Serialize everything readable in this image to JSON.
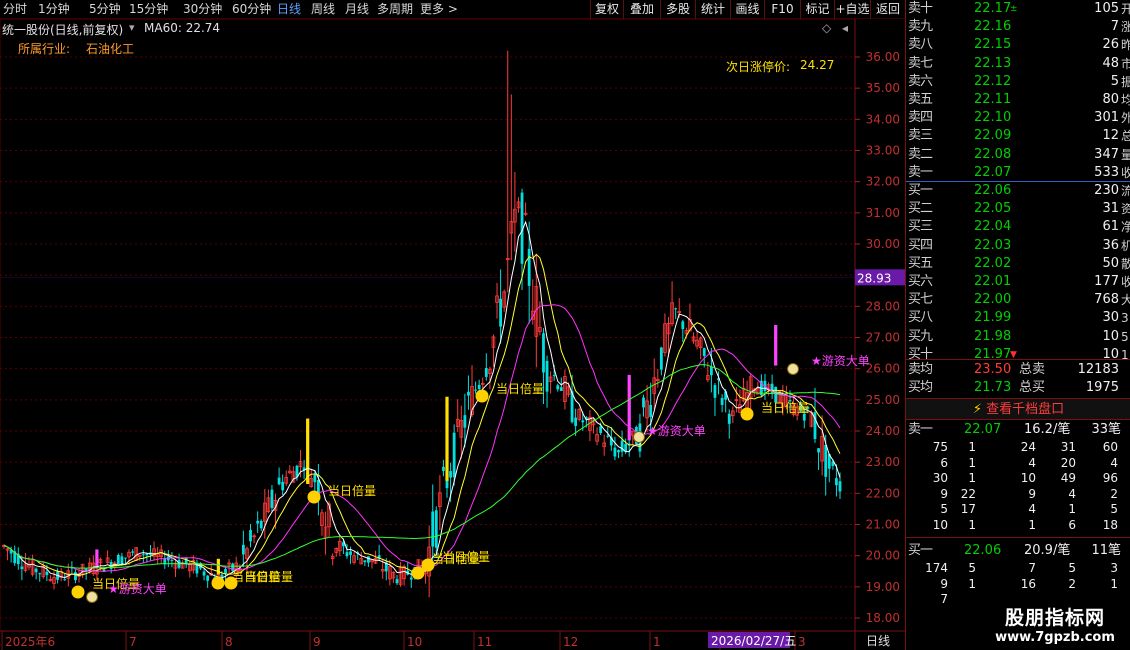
{
  "toolbar": {
    "periods": [
      "分时",
      "1分钟",
      "5分钟",
      "15分钟",
      "30分钟",
      "60分钟",
      "日线",
      "周线",
      "月线",
      "多周期",
      "更多 >"
    ],
    "active_period": "日线",
    "right_buttons": [
      "复权",
      "叠加",
      "多股",
      "统计",
      "画线",
      "F10",
      "标记",
      "+自选",
      "返回"
    ]
  },
  "chart": {
    "title": "统一股份(日线,前复权)",
    "ma_label": "MA60: 22.74",
    "industry_label": "所属行业:",
    "industry_value": "石油化工",
    "limit_up_label": "次日涨停价:",
    "limit_up_value": "24.27",
    "price_tag": "28.93",
    "date_tag": "2026/02/27/五",
    "period_label": "日线",
    "y_ticks": [
      "36.00",
      "35.00",
      "34.00",
      "33.00",
      "32.00",
      "31.00",
      "30.00",
      "29.00",
      "28.00",
      "27.00",
      "26.00",
      "25.00",
      "24.00",
      "23.00",
      "22.00",
      "21.00",
      "20.00",
      "19.00",
      "18.00"
    ],
    "x_labels": [
      "2025年6",
      "7",
      "8",
      "9",
      "10",
      "11",
      "12",
      "1",
      "2",
      "3"
    ],
    "annotations": {
      "double_volume": "当日倍量",
      "hot_money": "游资大单"
    },
    "colors": {
      "up": "#ff3b3b",
      "down": "#00e0e0",
      "ma_white": "#ffffff",
      "ma_yellow": "#ffff33",
      "ma_magenta": "#ff33ff",
      "ma_green": "#33ff33",
      "signal_yellow": "#ffe000",
      "signal_magenta": "#ff44ff"
    }
  },
  "chart_data": {
    "type": "candlestick",
    "title": "统一股份(日线,前复权)",
    "ylim": [
      17.7,
      36.6
    ],
    "x_labels": [
      "2025年6",
      "7",
      "8",
      "9",
      "10",
      "11",
      "12",
      "1",
      "2",
      "3"
    ],
    "series": [
      {
        "name": "MA60",
        "last": 22.74
      }
    ],
    "price_path": [
      [
        0,
        20.3
      ],
      [
        8,
        19.6
      ],
      [
        15,
        19.3
      ],
      [
        22,
        19.5
      ],
      [
        30,
        19.8
      ],
      [
        38,
        20.1
      ],
      [
        46,
        19.9
      ],
      [
        54,
        19.6
      ],
      [
        60,
        19.3
      ],
      [
        66,
        19.7
      ],
      [
        72,
        21.0
      ],
      [
        78,
        22.4
      ],
      [
        84,
        23.0
      ],
      [
        88,
        22.3
      ],
      [
        92,
        20.4
      ],
      [
        98,
        20.0
      ],
      [
        104,
        19.8
      ],
      [
        110,
        19.3
      ],
      [
        118,
        19.7
      ],
      [
        124,
        22.5
      ],
      [
        130,
        24.8
      ],
      [
        136,
        26.5
      ],
      [
        140,
        28.5
      ],
      [
        144,
        31.2
      ],
      [
        148,
        28.5
      ],
      [
        152,
        26.0
      ],
      [
        156,
        25.5
      ],
      [
        160,
        24.5
      ],
      [
        166,
        24.0
      ],
      [
        172,
        23.3
      ],
      [
        178,
        23.9
      ],
      [
        184,
        26.5
      ],
      [
        188,
        27.8
      ],
      [
        192,
        27.2
      ],
      [
        196,
        26.3
      ],
      [
        200,
        25.3
      ],
      [
        204,
        24.5
      ],
      [
        210,
        25.5
      ],
      [
        216,
        25.2
      ],
      [
        220,
        24.8
      ],
      [
        226,
        24.5
      ],
      [
        230,
        23.0
      ],
      [
        234,
        22.3
      ]
    ],
    "x_max": 234,
    "last_close": 22.06,
    "limit_up_next": 24.27,
    "high_marker": 28.93
  },
  "orderbook": {
    "asks": [
      {
        "label": "卖十",
        "price": "22.17",
        "vol": "105",
        "mark": "±",
        "edge": "开"
      },
      {
        "label": "卖九",
        "price": "22.16",
        "vol": "7",
        "mark": "",
        "edge": "涨"
      },
      {
        "label": "卖八",
        "price": "22.15",
        "vol": "26",
        "mark": "",
        "edge": "昨"
      },
      {
        "label": "卖七",
        "price": "22.13",
        "vol": "48",
        "mark": "",
        "edge": "市"
      },
      {
        "label": "卖六",
        "price": "22.12",
        "vol": "5",
        "mark": "",
        "edge": "振"
      },
      {
        "label": "卖五",
        "price": "22.11",
        "vol": "80",
        "mark": "",
        "edge": "均"
      },
      {
        "label": "卖四",
        "price": "22.10",
        "vol": "301",
        "mark": "",
        "edge": "外"
      },
      {
        "label": "卖三",
        "price": "22.09",
        "vol": "12",
        "mark": "",
        "edge": "总"
      },
      {
        "label": "卖二",
        "price": "22.08",
        "vol": "347",
        "mark": "",
        "edge": "量"
      },
      {
        "label": "卖一",
        "price": "22.07",
        "vol": "533",
        "mark": "",
        "edge": "收"
      }
    ],
    "bids": [
      {
        "label": "买一",
        "price": "22.06",
        "vol": "230",
        "mark": "",
        "edge": "流"
      },
      {
        "label": "买二",
        "price": "22.05",
        "vol": "31",
        "mark": "",
        "edge": "资"
      },
      {
        "label": "买三",
        "price": "22.04",
        "vol": "61",
        "mark": "",
        "edge": "净"
      },
      {
        "label": "买四",
        "price": "22.03",
        "vol": "36",
        "mark": "",
        "edge": "机"
      },
      {
        "label": "买五",
        "price": "22.02",
        "vol": "50",
        "mark": "",
        "edge": "散"
      },
      {
        "label": "买六",
        "price": "22.01",
        "vol": "177",
        "mark": "",
        "edge": "收"
      },
      {
        "label": "买七",
        "price": "22.00",
        "vol": "768",
        "mark": "",
        "edge": "大"
      },
      {
        "label": "买八",
        "price": "21.99",
        "vol": "30",
        "mark": "",
        "edge": "3"
      },
      {
        "label": "买九",
        "price": "21.98",
        "vol": "10",
        "mark": "",
        "edge": "5"
      },
      {
        "label": "买十",
        "price": "21.97",
        "vol": "10",
        "mark": "▼",
        "edge": "1"
      }
    ],
    "avg_sell_label": "卖均",
    "avg_sell_price": "23.50",
    "total_sell_label": "总卖",
    "total_sell": "12183",
    "avg_buy_label": "买均",
    "avg_buy_price": "21.73",
    "total_buy_label": "总买",
    "total_buy": "1975",
    "depth_button": "查看千档盘口",
    "sell1": {
      "label": "卖一",
      "price": "22.07",
      "per": "16.2/笔",
      "count": "33笔",
      "rows": [
        [
          "75",
          "1",
          "24",
          "31",
          "60"
        ],
        [
          "6",
          "1",
          "4",
          "20",
          "4"
        ],
        [
          "30",
          "1",
          "10",
          "49",
          "96"
        ],
        [
          "9",
          "22",
          "9",
          "4",
          "2"
        ],
        [
          "5",
          "17",
          "4",
          "1",
          "5"
        ],
        [
          "10",
          "1",
          "1",
          "6",
          "18"
        ]
      ]
    },
    "buy1": {
      "label": "买一",
      "price": "22.06",
      "per": "20.9/笔",
      "count": "11笔",
      "rows": [
        [
          "174",
          "5",
          "7",
          "5",
          "3"
        ],
        [
          "9",
          "1",
          "16",
          "2",
          "1"
        ],
        [
          "7",
          "",
          "",
          "",
          ""
        ]
      ]
    }
  },
  "watermark": {
    "line1": "股朋指标网",
    "line2": "www.7gpzb.com"
  }
}
